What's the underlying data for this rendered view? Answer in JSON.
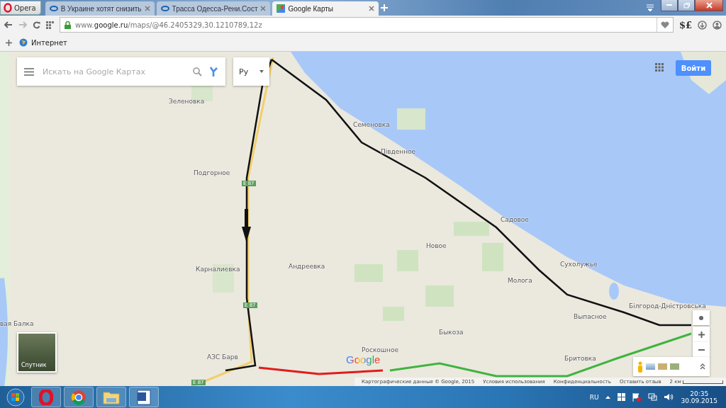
{
  "browser": {
    "menu_label": "Opera",
    "tabs": [
      {
        "title": "В Украине хотят снизить",
        "selected": false
      },
      {
        "title": "Трасса Одесса-Рени.Сост",
        "selected": false
      },
      {
        "title": "Google Карты",
        "selected": true
      }
    ],
    "address": "www.**google.ru**/maps/@46.2405329,30.1210789,12z",
    "extension": "$£",
    "bookmarks": [
      {
        "label": "Интернет"
      }
    ]
  },
  "map": {
    "search": {
      "placeholder": "Искать на Google Картах"
    },
    "language": "Ру",
    "sign_in": "Войти",
    "satellite_label": "Спутник",
    "places": [
      {
        "name": "Зеленовка"
      },
      {
        "name": "Семеновка"
      },
      {
        "name": "Південное"
      },
      {
        "name": "Подгорное"
      },
      {
        "name": "Садовое"
      },
      {
        "name": "Новое"
      },
      {
        "name": "Сухолужье"
      },
      {
        "name": "Карналиевка"
      },
      {
        "name": "Андреевка"
      },
      {
        "name": "Молога"
      },
      {
        "name": "Білгород-Дністровська"
      },
      {
        "name": "Выпасное"
      },
      {
        "name": "Быкоза"
      },
      {
        "name": "вая Балка"
      },
      {
        "name": "Роскошное"
      },
      {
        "name": "АЗС Барв"
      },
      {
        "name": "Бритовка"
      }
    ],
    "road_badges": [
      {
        "label": "E 87"
      },
      {
        "label": "E 87"
      },
      {
        "label": "E 87"
      }
    ],
    "logo": "Google",
    "footer": {
      "attribution": "Картографические данные © Google, 2015",
      "links": [
        "Условия использования",
        "Конфиденциальность",
        "Оставить отзыв"
      ],
      "scale": "2 км"
    }
  },
  "taskbar": {
    "apps": [
      {
        "kind": "opera",
        "selected": false
      },
      {
        "kind": "chrome",
        "selected": false
      },
      {
        "kind": "explorer",
        "selected": false
      },
      {
        "kind": "word",
        "selected": false
      }
    ],
    "language": "RU",
    "time": "20:35",
    "date": "30.09.2015"
  }
}
